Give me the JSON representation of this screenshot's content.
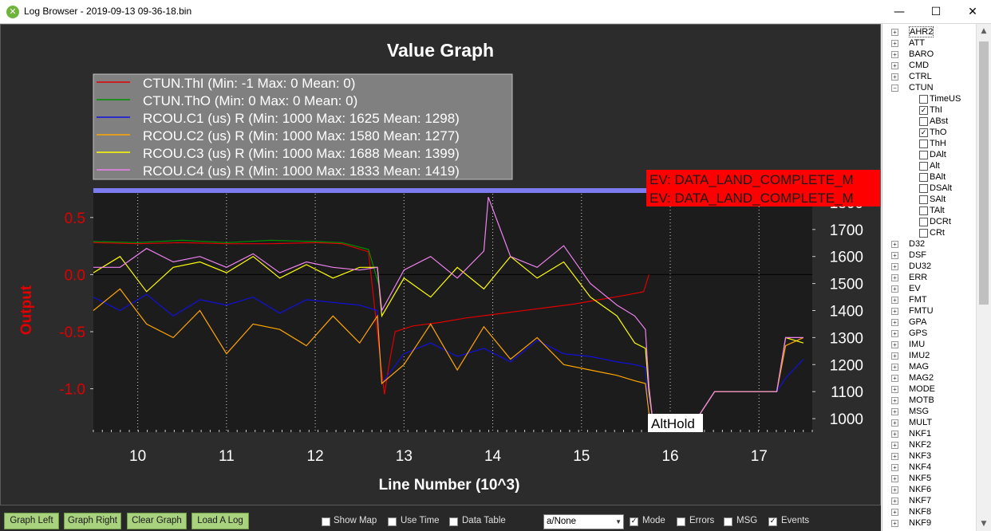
{
  "window": {
    "title": "Log Browser - 2019-09-13 09-36-18.bin",
    "minimize": "—",
    "maximize": "☐",
    "close": "✕"
  },
  "graph": {
    "title": "Value Graph",
    "ylabel": "Output",
    "xlabel": "Line Number (10^3)",
    "legend": [
      {
        "label": "CTUN.ThI (Min: -1 Max: 0 Mean: 0)",
        "color": "#e00000"
      },
      {
        "label": "CTUN.ThO (Min: 0 Max: 0 Mean: 0)",
        "color": "#009000"
      },
      {
        "label": "RCOU.C1 (us) R (Min: 1000 Max: 1625 Mean: 1298)",
        "color": "#1010e0"
      },
      {
        "label": "RCOU.C2 (us) R (Min: 1000 Max: 1580 Mean: 1277)",
        "color": "#ffa500"
      },
      {
        "label": "RCOU.C3 (us) R (Min: 1000 Max: 1688 Mean: 1399)",
        "color": "#ffff00"
      },
      {
        "label": "RCOU.C4 (us) R (Min: 1000 Max: 1833 Mean: 1419)",
        "color": "#ee82ee"
      }
    ],
    "events": [
      "EV: DATA_LAND_COMPLETE_M",
      "EV: DATA_LAND_COMPLETE_M"
    ],
    "mode_label": "AltHold"
  },
  "chart_data": {
    "type": "line",
    "title": "Value Graph",
    "xlabel": "Line Number (10^3)",
    "ylabel": "Output",
    "xlim": [
      9.5,
      17.6
    ],
    "ylim_left": [
      -1.38,
      0.75
    ],
    "ylim_right": [
      950,
      1850
    ],
    "x_ticks": [
      "10",
      "11",
      "12",
      "13",
      "14",
      "15",
      "16",
      "17"
    ],
    "x_tick_values": [
      10,
      11,
      12,
      13,
      14,
      15,
      16,
      17
    ],
    "y_left_ticks": [
      "0.5",
      "0.0",
      "-0.5",
      "-1.0"
    ],
    "y_left_tick_values": [
      0.5,
      0.0,
      -0.5,
      -1.0
    ],
    "y_right_ticks": [
      "1800",
      "1700",
      "1600",
      "1500",
      "1400",
      "1300",
      "1200",
      "1100",
      "1000"
    ],
    "y_right_tick_values": [
      1800,
      1700,
      1600,
      1500,
      1400,
      1300,
      1200,
      1100,
      1000
    ],
    "series": [
      {
        "name": "CTUN.ThI",
        "axis": "left",
        "color": "#e00000",
        "x": [
          9.5,
          10.0,
          10.5,
          11.0,
          11.5,
          12.0,
          12.3,
          12.6,
          12.72,
          12.78,
          12.84,
          12.9,
          13.1,
          13.4,
          13.7,
          14.0,
          14.3,
          14.6,
          14.9,
          15.2,
          15.5,
          15.7,
          15.76
        ],
        "y": [
          0.28,
          0.27,
          0.28,
          0.27,
          0.27,
          0.28,
          0.27,
          0.2,
          -0.65,
          -1.05,
          -0.75,
          -0.5,
          -0.45,
          -0.42,
          -0.38,
          -0.35,
          -0.32,
          -0.29,
          -0.26,
          -0.22,
          -0.18,
          -0.15,
          0.0
        ]
      },
      {
        "name": "CTUN.ThO",
        "axis": "left",
        "color": "#009000",
        "x": [
          9.5,
          10.0,
          10.5,
          11.0,
          11.5,
          12.0,
          12.3,
          12.6,
          12.72
        ],
        "y": [
          0.29,
          0.28,
          0.3,
          0.28,
          0.3,
          0.29,
          0.28,
          0.22,
          -0.1
        ]
      },
      {
        "name": "RCOU.C1",
        "axis": "right",
        "color": "#1010e0",
        "x": [
          9.5,
          9.8,
          10.1,
          10.4,
          10.7,
          11.0,
          11.3,
          11.6,
          11.9,
          12.2,
          12.5,
          12.7,
          12.75,
          13.0,
          13.3,
          13.6,
          13.9,
          14.2,
          14.5,
          14.8,
          15.1,
          15.4,
          15.6,
          15.72,
          15.76,
          15.8,
          16.0,
          16.3,
          16.5,
          16.8,
          17.0,
          17.2,
          17.3,
          17.5
        ],
        "y": [
          1450,
          1400,
          1460,
          1380,
          1440,
          1420,
          1450,
          1390,
          1440,
          1430,
          1420,
          1400,
          1130,
          1240,
          1280,
          1230,
          1260,
          1210,
          1290,
          1240,
          1230,
          1210,
          1200,
          1190,
          1020,
          1000,
          1000,
          1000,
          1100,
          1100,
          1100,
          1100,
          1150,
          1220
        ]
      },
      {
        "name": "RCOU.C2",
        "axis": "right",
        "color": "#ffa500",
        "x": [
          9.5,
          9.8,
          10.1,
          10.4,
          10.7,
          11.0,
          11.3,
          11.6,
          11.9,
          12.2,
          12.5,
          12.7,
          12.75,
          13.0,
          13.3,
          13.6,
          13.9,
          14.2,
          14.5,
          14.8,
          15.1,
          15.4,
          15.6,
          15.72,
          15.76,
          15.8,
          16.0,
          16.3,
          16.5,
          16.8,
          17.0,
          17.2,
          17.3,
          17.5
        ],
        "y": [
          1400,
          1480,
          1350,
          1300,
          1400,
          1240,
          1350,
          1330,
          1270,
          1380,
          1280,
          1380,
          1130,
          1200,
          1350,
          1180,
          1340,
          1220,
          1300,
          1200,
          1180,
          1160,
          1140,
          1130,
          1020,
          1000,
          1000,
          1000,
          1100,
          1100,
          1100,
          1100,
          1270,
          1300
        ]
      },
      {
        "name": "RCOU.C3",
        "axis": "right",
        "color": "#ffff00",
        "x": [
          9.5,
          9.8,
          10.1,
          10.4,
          10.7,
          11.0,
          11.3,
          11.6,
          11.9,
          12.2,
          12.5,
          12.7,
          12.75,
          13.0,
          13.3,
          13.6,
          13.9,
          14.2,
          14.5,
          14.8,
          15.1,
          15.4,
          15.6,
          15.72,
          15.76,
          15.8,
          16.0,
          16.3,
          16.5,
          16.8,
          17.0,
          17.2,
          17.3,
          17.5
        ],
        "y": [
          1540,
          1600,
          1470,
          1560,
          1580,
          1540,
          1600,
          1520,
          1570,
          1520,
          1560,
          1560,
          1380,
          1520,
          1450,
          1560,
          1480,
          1600,
          1520,
          1580,
          1450,
          1380,
          1280,
          1260,
          1100,
          1000,
          1000,
          1000,
          1100,
          1100,
          1100,
          1100,
          1300,
          1280
        ]
      },
      {
        "name": "RCOU.C4",
        "axis": "right",
        "color": "#ee82ee",
        "x": [
          9.5,
          9.8,
          10.1,
          10.4,
          10.7,
          11.0,
          11.3,
          11.6,
          11.9,
          12.2,
          12.5,
          12.7,
          12.75,
          13.0,
          13.3,
          13.6,
          13.9,
          13.95,
          14.2,
          14.5,
          14.8,
          15.1,
          15.4,
          15.6,
          15.72,
          15.76,
          15.8,
          16.0,
          16.3,
          16.5,
          16.8,
          17.0,
          17.2,
          17.3,
          17.5
        ],
        "y": [
          1560,
          1560,
          1630,
          1580,
          1600,
          1560,
          1610,
          1540,
          1580,
          1560,
          1550,
          1560,
          1400,
          1550,
          1600,
          1520,
          1620,
          1820,
          1600,
          1560,
          1640,
          1500,
          1420,
          1380,
          1330,
          1120,
          1000,
          1000,
          1000,
          1100,
          1100,
          1100,
          1100,
          1300,
          1300
        ]
      }
    ]
  },
  "tree": {
    "items": [
      {
        "type": "group",
        "label": "AHR2",
        "expanded": false
      },
      {
        "type": "group",
        "label": "ATT",
        "expanded": false
      },
      {
        "type": "group",
        "label": "BARO",
        "expanded": false
      },
      {
        "type": "group",
        "label": "CMD",
        "expanded": false
      },
      {
        "type": "group",
        "label": "CTRL",
        "expanded": false
      },
      {
        "type": "group",
        "label": "CTUN",
        "expanded": true
      },
      {
        "type": "field",
        "label": "TimeUS",
        "checked": false
      },
      {
        "type": "field",
        "label": "ThI",
        "checked": true
      },
      {
        "type": "field",
        "label": "ABst",
        "checked": false
      },
      {
        "type": "field",
        "label": "ThO",
        "checked": true
      },
      {
        "type": "field",
        "label": "ThH",
        "checked": false
      },
      {
        "type": "field",
        "label": "DAlt",
        "checked": false
      },
      {
        "type": "field",
        "label": "Alt",
        "checked": false
      },
      {
        "type": "field",
        "label": "BAlt",
        "checked": false
      },
      {
        "type": "field",
        "label": "DSAlt",
        "checked": false
      },
      {
        "type": "field",
        "label": "SAlt",
        "checked": false
      },
      {
        "type": "field",
        "label": "TAlt",
        "checked": false
      },
      {
        "type": "field",
        "label": "DCRt",
        "checked": false
      },
      {
        "type": "field",
        "label": "CRt",
        "checked": false
      },
      {
        "type": "group",
        "label": "D32",
        "expanded": false
      },
      {
        "type": "group",
        "label": "DSF",
        "expanded": false
      },
      {
        "type": "group",
        "label": "DU32",
        "expanded": false
      },
      {
        "type": "group",
        "label": "ERR",
        "expanded": false
      },
      {
        "type": "group",
        "label": "EV",
        "expanded": false
      },
      {
        "type": "group",
        "label": "FMT",
        "expanded": false
      },
      {
        "type": "group",
        "label": "FMTU",
        "expanded": false
      },
      {
        "type": "group",
        "label": "GPA",
        "expanded": false
      },
      {
        "type": "group",
        "label": "GPS",
        "expanded": false
      },
      {
        "type": "group",
        "label": "IMU",
        "expanded": false
      },
      {
        "type": "group",
        "label": "IMU2",
        "expanded": false
      },
      {
        "type": "group",
        "label": "MAG",
        "expanded": false
      },
      {
        "type": "group",
        "label": "MAG2",
        "expanded": false
      },
      {
        "type": "group",
        "label": "MODE",
        "expanded": false
      },
      {
        "type": "group",
        "label": "MOTB",
        "expanded": false
      },
      {
        "type": "group",
        "label": "MSG",
        "expanded": false
      },
      {
        "type": "group",
        "label": "MULT",
        "expanded": false
      },
      {
        "type": "group",
        "label": "NKF1",
        "expanded": false
      },
      {
        "type": "group",
        "label": "NKF2",
        "expanded": false
      },
      {
        "type": "group",
        "label": "NKF3",
        "expanded": false
      },
      {
        "type": "group",
        "label": "NKF4",
        "expanded": false
      },
      {
        "type": "group",
        "label": "NKF5",
        "expanded": false
      },
      {
        "type": "group",
        "label": "NKF6",
        "expanded": false
      },
      {
        "type": "group",
        "label": "NKF7",
        "expanded": false
      },
      {
        "type": "group",
        "label": "NKF8",
        "expanded": false
      },
      {
        "type": "group",
        "label": "NKF9",
        "expanded": false
      }
    ]
  },
  "toolbar": {
    "graph_left": "Graph Left",
    "graph_right": "Graph Right",
    "clear_graph": "Clear Graph",
    "load_log": "Load A Log",
    "show_map": "Show Map",
    "use_time": "Use Time",
    "data_table": "Data Table",
    "combo_value": "a/None",
    "mode": "Mode",
    "errors": "Errors",
    "msg": "MSG",
    "events": "Events",
    "mode_checked": true,
    "errors_checked": false,
    "msg_checked": false,
    "events_checked": true,
    "show_map_checked": false,
    "use_time_checked": false,
    "data_table_checked": false
  }
}
